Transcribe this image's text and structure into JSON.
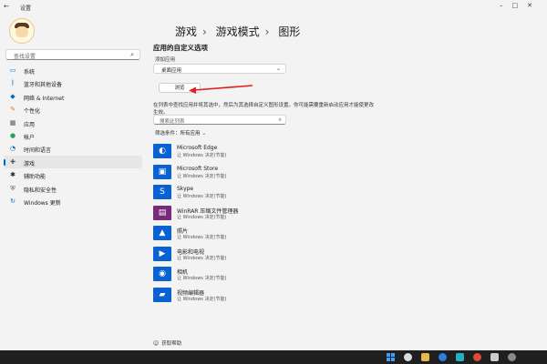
{
  "window": {
    "title": "设置",
    "back_icon": "back-arrow-icon",
    "controls": [
      "minimize-icon",
      "maximize-icon",
      "close-icon"
    ]
  },
  "sidebar": {
    "search_placeholder": "查找设置",
    "items": [
      {
        "label": "系统",
        "icon": "monitor-icon",
        "color": "#0067c0",
        "active": false
      },
      {
        "label": "蓝牙和其他设备",
        "icon": "bluetooth-icon",
        "color": "#0067c0",
        "active": false
      },
      {
        "label": "网络 & Internet",
        "icon": "wifi-icon",
        "color": "#0067c0",
        "active": false
      },
      {
        "label": "个性化",
        "icon": "brush-icon",
        "color": "#d97a2b",
        "active": false
      },
      {
        "label": "应用",
        "icon": "apps-icon",
        "color": "#555555",
        "active": false
      },
      {
        "label": "帐户",
        "icon": "person-icon",
        "color": "#2f9e5a",
        "active": false
      },
      {
        "label": "时间和语言",
        "icon": "globe-clock-icon",
        "color": "#0067c0",
        "active": false
      },
      {
        "label": "游戏",
        "icon": "gamepad-icon",
        "color": "#555555",
        "active": true
      },
      {
        "label": "辅助功能",
        "icon": "accessibility-icon",
        "color": "#222222",
        "active": false
      },
      {
        "label": "隐私和安全性",
        "icon": "shield-icon",
        "color": "#555555",
        "active": false
      },
      {
        "label": "Windows 更新",
        "icon": "update-icon",
        "color": "#0067c0",
        "active": false
      }
    ]
  },
  "main": {
    "breadcrumb": [
      "游戏",
      "游戏模式",
      "图形"
    ],
    "section_title": "应用的自定义选项",
    "add_app_label": "添加应用",
    "add_app_value": "桌面应用",
    "browse_label": "浏览",
    "description": "在列表中查找应用并将其选中，然后为其选择自定义图形设置。你可能需要重新启动应用才能使更改生效。",
    "list_search_placeholder": "搜索此列表",
    "filter_label": "筛选条件：",
    "filter_value": "所有应用",
    "apps": [
      {
        "name": "Microsoft Edge",
        "status": "让 Windows 决定(节能)",
        "icon": "edge-icon",
        "tile": "#0a61d1"
      },
      {
        "name": "Microsoft Store",
        "status": "让 Windows 决定(节能)",
        "icon": "store-icon",
        "tile": "#0a61d1"
      },
      {
        "name": "Skype",
        "status": "让 Windows 决定(节能)",
        "icon": "skype-icon",
        "tile": "#0a61d1"
      },
      {
        "name": "WinRAR 压缩文件管理器",
        "status": "让 Windows 决定(节能)",
        "icon": "winrar-icon",
        "tile": "#7a2a7a"
      },
      {
        "name": "照片",
        "status": "让 Windows 决定(节能)",
        "icon": "photos-icon",
        "tile": "#0a61d1"
      },
      {
        "name": "电影和电视",
        "status": "让 Windows 决定(节能)",
        "icon": "film-icon",
        "tile": "#0a61d1"
      },
      {
        "name": "相机",
        "status": "让 Windows 决定(节能)",
        "icon": "camera-icon",
        "tile": "#0a61d1"
      },
      {
        "name": "视频编辑器",
        "status": "让 Windows 决定(节能)",
        "icon": "video-editor-icon",
        "tile": "#0a61d1"
      }
    ],
    "help_label": "获取帮助"
  },
  "annotation": {
    "color": "#e02020"
  },
  "taskbar": {
    "icons": [
      {
        "name": "start-icon",
        "color": "#3aa0ff"
      },
      {
        "name": "search-icon",
        "color": "#dddddd"
      },
      {
        "name": "file-explorer-icon",
        "color": "#e8b84a"
      },
      {
        "name": "store-icon",
        "color": "#2a7fe0"
      },
      {
        "name": "edge-icon",
        "color": "#1fb3c9"
      },
      {
        "name": "chrome-icon",
        "color": "#e04a3a"
      },
      {
        "name": "network-icon",
        "color": "#cccccc"
      },
      {
        "name": "settings-icon",
        "color": "#8a8a8a"
      }
    ]
  }
}
